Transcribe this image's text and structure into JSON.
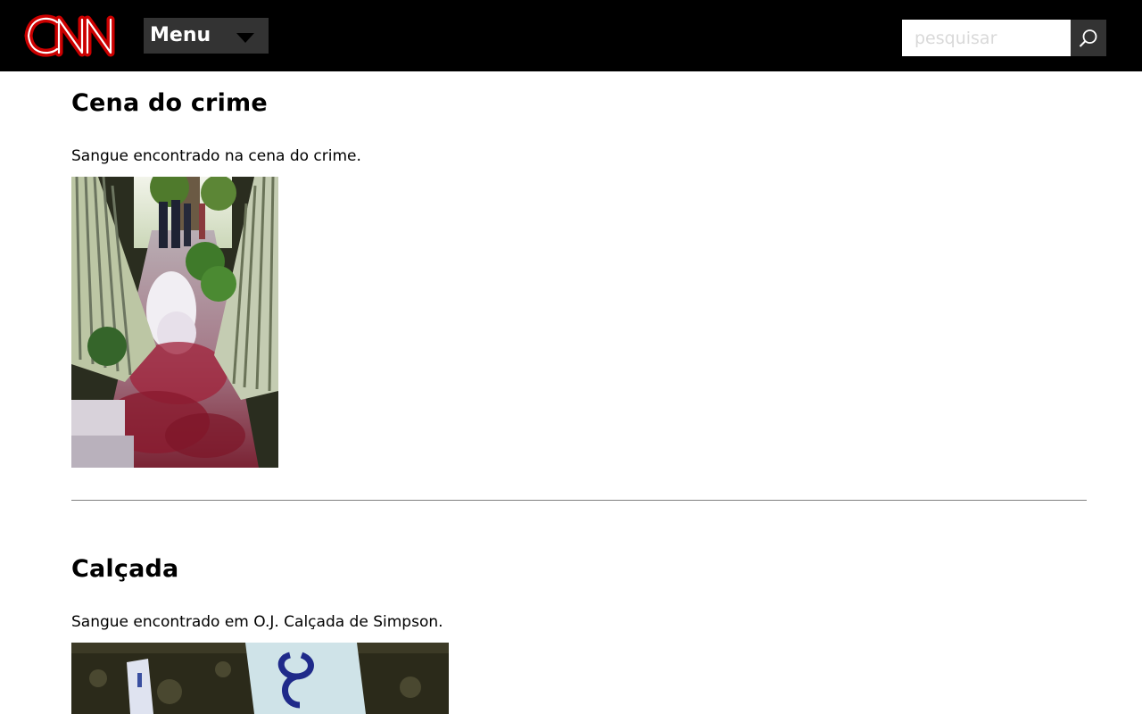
{
  "header": {
    "logo_text": "CNN",
    "menu_label": "Menu",
    "search_placeholder": "pesquisar",
    "search_icon": "search-icon",
    "menu_icon": "caret-down-icon"
  },
  "articles": [
    {
      "title": "Cena do crime",
      "caption": "Sangue encontrado na cena do crime."
    },
    {
      "title": "Calçada",
      "caption": "Sangue encontrado em O.J. Calçada de Simpson."
    }
  ],
  "colors": {
    "header_bg": "#000000",
    "menu_bg": "#333333",
    "logo_red": "#cc0000"
  }
}
